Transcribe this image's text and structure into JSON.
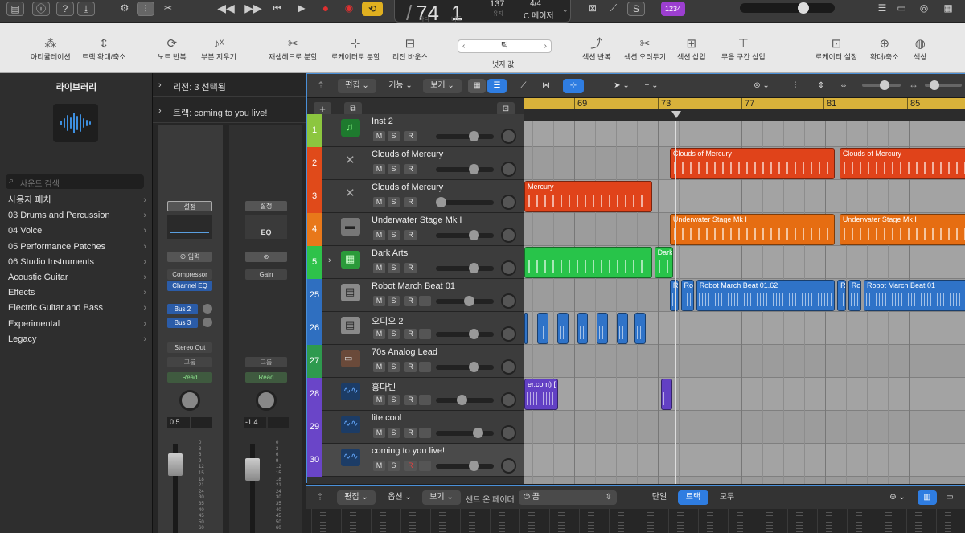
{
  "topbar": {
    "lcd_position": "74",
    "lcd_beat": "1",
    "lcd_bar_label": "마디",
    "lcd_beat_label": "비트",
    "lcd_tempo_value": "137",
    "lcd_tempo_label": "유지",
    "lcd_signature": "4/4",
    "lcd_key": "C 메이저",
    "count_in": "1234"
  },
  "toolbar": {
    "items": [
      {
        "label": "아티큘레이션",
        "icon": "articulation-icon"
      },
      {
        "label": "트랙 확대/축소",
        "icon": "track-zoom-icon"
      },
      {
        "label": "노트 반복",
        "icon": "note-repeat-icon"
      },
      {
        "label": "부분 지우기",
        "icon": "partial-erase-icon"
      },
      {
        "label": "재생헤드로 분할",
        "icon": "split-playhead-icon"
      },
      {
        "label": "로케이터로 분할",
        "icon": "split-locators-icon"
      },
      {
        "label": "리전 바운스",
        "icon": "bounce-region-icon"
      },
      {
        "label": "넛지 값",
        "icon": "nudge-icon"
      },
      {
        "label": "섹션 반복",
        "icon": "section-repeat-icon"
      },
      {
        "label": "섹션 오려두기",
        "icon": "section-cut-icon"
      },
      {
        "label": "섹션 삽입",
        "icon": "section-insert-icon"
      },
      {
        "label": "무음 구간 삽입",
        "icon": "silence-insert-icon"
      },
      {
        "label": "로케이터 설정",
        "icon": "locator-set-icon"
      },
      {
        "label": "확대/축소",
        "icon": "zoom-icon"
      },
      {
        "label": "색상",
        "icon": "palette-icon"
      }
    ],
    "nudge_value": "틱"
  },
  "library": {
    "title": "라이브러리",
    "search_placeholder": "사운드 검색",
    "items": [
      "사용자 패치",
      "03 Drums and Percussion",
      "04 Voice",
      "05 Performance Patches",
      "06 Studio Instruments",
      "Acoustic Guitar",
      "Effects",
      "Electric Guitar and Bass",
      "Experimental",
      "Legacy"
    ]
  },
  "inspector": {
    "region_label": "리전: 3 선택됨",
    "track_label": "트랙: coming to you live!",
    "strip1": {
      "settings": "설정",
      "input": "입력",
      "plugin1": "Compressor",
      "plugin2": "Channel EQ",
      "send1": "Bus 2",
      "send2": "Bus 3",
      "output": "Stereo Out",
      "group": "그룹",
      "automation": "Read",
      "volume": "0.5"
    },
    "strip2": {
      "settings": "설정",
      "eq": "EQ",
      "plugin1": "Gain",
      "group": "그룹",
      "automation": "Read",
      "volume": "-1.4"
    },
    "meter_scale": [
      "0",
      "3",
      "6",
      "9",
      "12",
      "15",
      "18",
      "21",
      "24",
      "30",
      "35",
      "40",
      "45",
      "50",
      "60"
    ]
  },
  "tracks_menu": {
    "edit": "편집",
    "functions": "기능",
    "view": "보기"
  },
  "ruler": {
    "bars": [
      "69",
      "73",
      "77",
      "81",
      "85"
    ]
  },
  "tracks": [
    {
      "num": "1",
      "name": "Inst 2",
      "color": "#8cc63f",
      "fader": 0.7,
      "icon": "music-note-icon"
    },
    {
      "num": "2",
      "name": "Clouds of Mercury",
      "color": "#e04a1a",
      "fader": 0.7,
      "icon": "keyboard-stand-icon"
    },
    {
      "num": "3",
      "name": "Clouds of Mercury",
      "color": "#e04a1a",
      "fader": 0.0,
      "icon": "keyboard-stand-icon"
    },
    {
      "num": "4",
      "name": "Underwater Stage Mk I",
      "color": "#e8781a",
      "fader": 0.7,
      "icon": "electric-piano-icon"
    },
    {
      "num": "5",
      "name": "Dark Arts",
      "color": "#2ec24a",
      "fader": 0.7,
      "icon": "drum-machine-icon"
    },
    {
      "num": "25",
      "name": "Robot March Beat 01",
      "color": "#2f6fc0",
      "fader": 0.6,
      "icon": "beat-machine-icon"
    },
    {
      "num": "26",
      "name": "오디오 2",
      "color": "#2f6fc0",
      "fader": 0.7,
      "icon": "beat-machine-icon"
    },
    {
      "num": "27",
      "name": "70s Analog Lead",
      "color": "#2e9a4e",
      "fader": 0.7,
      "icon": "synth-icon"
    },
    {
      "num": "28",
      "name": "홍다빈",
      "color": "#6a45c8",
      "fader": 0.45,
      "icon": "waveform-icon"
    },
    {
      "num": "29",
      "name": "lite cool",
      "color": "#6a45c8",
      "fader": 0.8,
      "icon": "waveform-icon"
    },
    {
      "num": "30",
      "name": "coming to you live!",
      "color": "#6a45c8",
      "fader": 0.7,
      "icon": "waveform-icon"
    }
  ],
  "regions": [
    {
      "label": "Clouds of Mercury",
      "row": 1,
      "start": 0.33,
      "end": 0.705,
      "color": "#e0431a",
      "kind": "midi"
    },
    {
      "label": "Clouds of Mercury",
      "row": 1,
      "start": 0.715,
      "end": 1.1,
      "color": "#e0431a",
      "kind": "midi"
    },
    {
      "label": "Mercury",
      "row": 2,
      "start": 0.0,
      "end": 0.29,
      "color": "#e0431a",
      "kind": "midi"
    },
    {
      "label": "Underwater Stage Mk I",
      "row": 3,
      "start": 0.33,
      "end": 0.705,
      "color": "#e66d12",
      "kind": "midi"
    },
    {
      "label": "Underwater Stage Mk I",
      "row": 3,
      "start": 0.715,
      "end": 1.1,
      "color": "#e66d12",
      "kind": "midi"
    },
    {
      "label": "",
      "row": 4,
      "start": 0.0,
      "end": 0.29,
      "color": "#28c44a",
      "kind": "midi"
    },
    {
      "label": "Dark",
      "row": 4,
      "start": 0.295,
      "end": 0.337,
      "color": "#28c44a",
      "kind": "midi"
    },
    {
      "label": "R",
      "row": 5,
      "start": 0.33,
      "end": 0.35,
      "color": "#2f73c8",
      "kind": "audio"
    },
    {
      "label": "Ro",
      "row": 5,
      "start": 0.355,
      "end": 0.385,
      "color": "#2f73c8",
      "kind": "audio"
    },
    {
      "label": "Robot March Beat 01.62",
      "row": 5,
      "start": 0.39,
      "end": 0.705,
      "color": "#2f73c8",
      "kind": "audio"
    },
    {
      "label": "R",
      "row": 5,
      "start": 0.71,
      "end": 0.73,
      "color": "#2f73c8",
      "kind": "audio"
    },
    {
      "label": "Ro",
      "row": 5,
      "start": 0.735,
      "end": 0.765,
      "color": "#2f73c8",
      "kind": "audio"
    },
    {
      "label": "Robot March Beat 01",
      "row": 5,
      "start": 0.77,
      "end": 1.1,
      "color": "#2f73c8",
      "kind": "audio"
    },
    {
      "label": "",
      "row": 6,
      "start": 0.0,
      "end": 0.007,
      "color": "#2f73c8",
      "kind": "audio"
    },
    {
      "label": "",
      "row": 6,
      "start": 0.03,
      "end": 0.055,
      "color": "#2f73c8",
      "kind": "audio"
    },
    {
      "label": "",
      "row": 6,
      "start": 0.075,
      "end": 0.1,
      "color": "#2f73c8",
      "kind": "audio"
    },
    {
      "label": "",
      "row": 6,
      "start": 0.12,
      "end": 0.145,
      "color": "#2f73c8",
      "kind": "audio"
    },
    {
      "label": "",
      "row": 6,
      "start": 0.165,
      "end": 0.19,
      "color": "#2f73c8",
      "kind": "audio"
    },
    {
      "label": "",
      "row": 6,
      "start": 0.21,
      "end": 0.235,
      "color": "#2f73c8",
      "kind": "audio"
    },
    {
      "label": "",
      "row": 6,
      "start": 0.25,
      "end": 0.275,
      "color": "#2f73c8",
      "kind": "audio"
    },
    {
      "label": "er.com) [",
      "row": 8,
      "start": 0.0,
      "end": 0.077,
      "color": "#6240c4",
      "kind": "audio"
    },
    {
      "label": "",
      "row": 8,
      "start": 0.31,
      "end": 0.335,
      "color": "#6240c4",
      "kind": "audio"
    }
  ],
  "mixer_bar": {
    "edit": "편집",
    "options": "옵션",
    "view": "보기",
    "sends_on_faders": "센드 온 페이더",
    "sends_value": "끔",
    "mode_single": "단일",
    "mode_tracks": "트랙",
    "mode_all": "모두"
  },
  "colors": {
    "accent_blue": "#2f7de1",
    "ruler_yellow": "#d9b23a",
    "record_red": "#e03030",
    "cycle_yellow": "#e0b020"
  }
}
